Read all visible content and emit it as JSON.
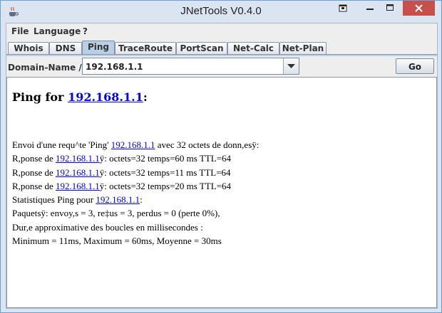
{
  "window": {
    "title": "JNetTools V0.4.0"
  },
  "menu": [
    "File",
    "Language",
    "?"
  ],
  "tabs": [
    "Whois",
    "DNS",
    "Ping",
    "TraceRoute",
    "PortScan",
    "Net-Calc",
    "Net-Plan"
  ],
  "selected_tab": "Ping",
  "input": {
    "label": "Domain-Name / IP:",
    "value": "192.168.1.1",
    "go_label": "Go"
  },
  "output": {
    "title_prefix": "Ping for ",
    "title_link": "192.168.1.1",
    "title_suffix": ":",
    "lines": [
      {
        "pre": "Envoi d'une requ^te 'Ping' ",
        "link": "192.168.1.1",
        "post": " avec 32 octets de donn,esÿ:"
      },
      {
        "pre": "R,ponse de ",
        "link": "192.168.1.1",
        "post": "ÿ: octets=32 temps=60 ms TTL=64"
      },
      {
        "pre": "R,ponse de ",
        "link": "192.168.1.1",
        "post": "ÿ: octets=32 temps=11 ms TTL=64"
      },
      {
        "pre": "R,ponse de ",
        "link": "192.168.1.1",
        "post": "ÿ: octets=32 temps=20 ms TTL=64"
      },
      {
        "pre": "Statistiques Ping pour ",
        "link": "192.168.1.1",
        "post": ":"
      },
      {
        "pre": "Paquetsÿ: envoy,s = 3, re‡us = 3, perdus = 0 (perte 0%),",
        "link": "",
        "post": ""
      },
      {
        "pre": "Dur,e approximative des boucles en millisecondes :",
        "link": "",
        "post": ""
      },
      {
        "pre": "Minimum = 11ms, Maximum = 60ms, Moyenne = 30ms",
        "link": "",
        "post": ""
      }
    ]
  },
  "icons": {
    "app": "java-cup-icon",
    "restore": "restore-icon",
    "minimize": "minimize-icon",
    "maximize": "maximize-icon",
    "close": "close-icon",
    "dropdown": "chevron-down-icon"
  },
  "colors": {
    "link": "#0000ee",
    "close_button": "#c7504b",
    "selected_tab": "#b8cfe5",
    "title_bar": "#dbe5f1"
  }
}
